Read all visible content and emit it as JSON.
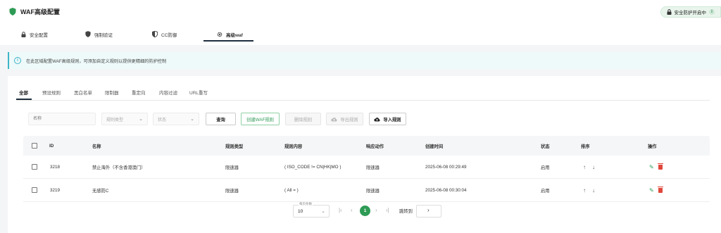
{
  "header": {
    "title": "WAF高级配置",
    "status_badge": "安全防护开启中",
    "info_mark": "i"
  },
  "tabs": [
    {
      "label": "安全配置",
      "icon": "lock-icon"
    },
    {
      "label": "强制验证",
      "icon": "shield-icon"
    },
    {
      "label": "CC防御",
      "icon": "shield-half-icon"
    },
    {
      "label": "高级waf",
      "icon": "gear-icon",
      "active": true
    }
  ],
  "info_bar": {
    "icon_mark": "i",
    "text": "在此区域配置WAF高级规则，可添加自定义规则以提供更精细的防护控制"
  },
  "sub_tabs": [
    "全部",
    "预设规则",
    "黑白名单",
    "限制器",
    "重定向",
    "内容过滤",
    "URL重写"
  ],
  "filters": {
    "name_placeholder": "名称",
    "rule_type_placeholder": "规则类型",
    "status_placeholder": "状态",
    "query_label": "查询",
    "create_label": "创建WAF规则",
    "delete_label": "删除规则",
    "export_label": "导出规则",
    "import_label": "导入规则"
  },
  "table": {
    "headers": {
      "id": "ID",
      "name": "名称",
      "type": "规则类型",
      "content": "规则内容",
      "action": "响应动作",
      "created": "创建时间",
      "status": "状态",
      "sort": "排序",
      "ops": "操作"
    },
    "rows": [
      {
        "id": "3218",
        "name": "禁止海外（不含香港澳门）",
        "type": "限速器",
        "content": "( ISO_CODE != CN|HK|MO )",
        "action": "限速器",
        "created": "2025-06-08 00:29:49",
        "status": "启用"
      },
      {
        "id": "3219",
        "name": "无感防C",
        "type": "限速器",
        "content": "( All = )",
        "action": "限速器",
        "created": "2025-06-08 00:30:04",
        "status": "启用"
      }
    ]
  },
  "pagination": {
    "page_size_label": "每页条数",
    "page_size": "10",
    "current_page": "1",
    "jump_label": "跳转到"
  },
  "colors": {
    "accent_green": "#2e9b55",
    "info_cyan": "#3fb4c8",
    "delete_red": "#e0463a"
  }
}
